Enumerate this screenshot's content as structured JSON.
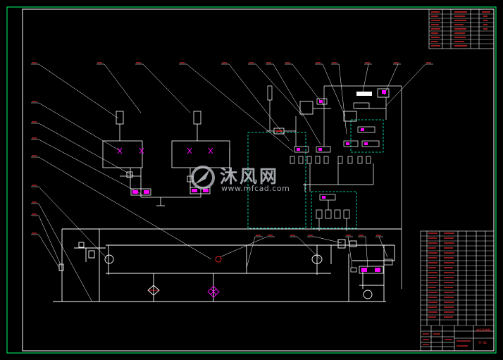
{
  "drawing": {
    "background": "#000000",
    "line_color": "#ffffff",
    "frame_color": "#00ff66",
    "dash_color": "#00ffcc",
    "valve_color": "#ff00ff",
    "accent_red": "#ff2222",
    "label_color": "#ff3333"
  },
  "watermark": {
    "brand": "沐风网",
    "url": "www.mfcad.com"
  },
  "title_block": {
    "name_line": "液压系统图",
    "code_line": "YY-01"
  }
}
